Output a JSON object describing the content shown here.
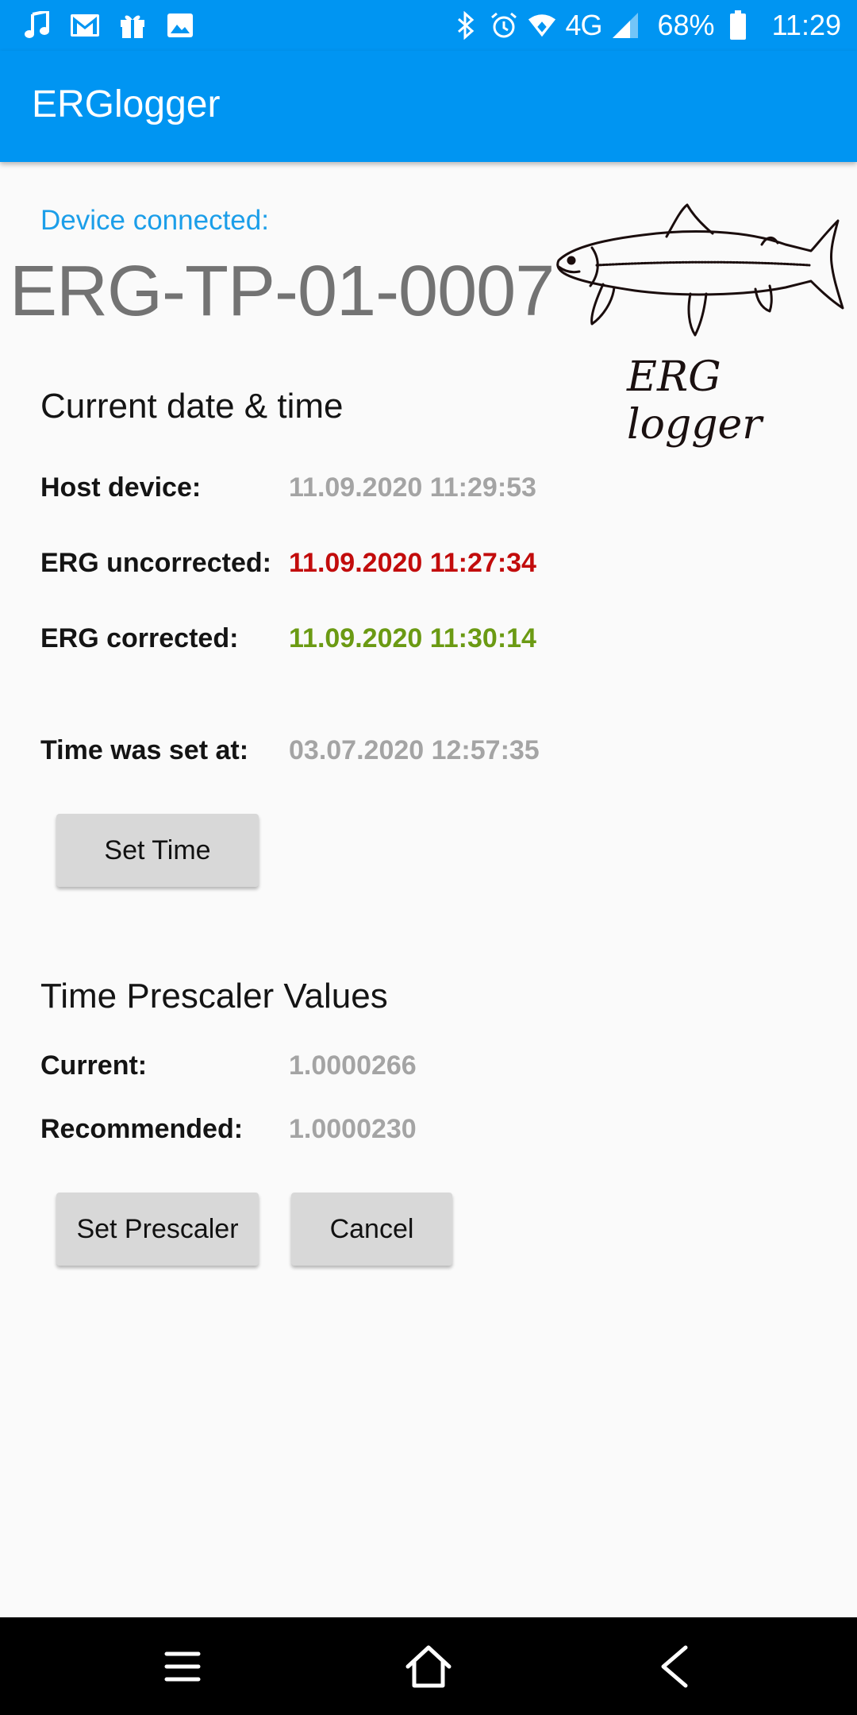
{
  "status_bar": {
    "left_icons": [
      "music-icon",
      "gmail-icon",
      "gift-icon",
      "image-icon"
    ],
    "right_icons": [
      "bluetooth-icon",
      "alarm-icon",
      "wifi-icon",
      "cell-signal-icon",
      "battery-icon"
    ],
    "network": "4G",
    "battery": "68%",
    "time": "11:29"
  },
  "app_bar": {
    "title": "ERGlogger"
  },
  "device": {
    "connected_label": "Device connected:",
    "name": "ERG-TP-01-0007"
  },
  "logo": {
    "caption": "ERG logger"
  },
  "datetime": {
    "title": "Current date & time",
    "host_label": "Host device:",
    "host_value": "11.09.2020 11:29:53",
    "uncorrected_label": "ERG uncorrected:",
    "uncorrected_value": "11.09.2020 11:27:34",
    "corrected_label": "ERG corrected:",
    "corrected_value": "11.09.2020 11:30:14",
    "set_at_label": "Time was set at:",
    "set_at_value": "03.07.2020 12:57:35",
    "set_time_button": "Set Time"
  },
  "prescaler": {
    "title": "Time Prescaler Values",
    "current_label": "Current:",
    "current_value": "1.0000266",
    "recommended_label": "Recommended:",
    "recommended_value": "1.0000230",
    "set_button": "Set Prescaler",
    "cancel_button": "Cancel"
  },
  "nav_bar": {
    "buttons": [
      "menu-icon",
      "home-icon",
      "back-icon"
    ]
  },
  "colors": {
    "primary": "#0095f2",
    "accent_text": "#1b9ee9",
    "uncorrected": "#c20c0c",
    "corrected": "#6b9a13",
    "muted_value": "#a4a4a4",
    "button_bg": "#d8d8d8"
  }
}
